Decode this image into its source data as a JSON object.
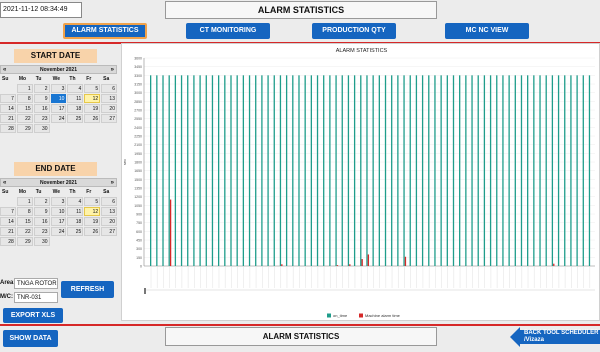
{
  "header": {
    "datetime": "2021-11-12 08:34:49",
    "title": "ALARM STATISTICS"
  },
  "nav": [
    {
      "label": "ALARM STATISTICS",
      "active": true
    },
    {
      "label": "CT MONITORING",
      "active": false
    },
    {
      "label": "PRODUCTION QTY",
      "active": false
    },
    {
      "label": "MC NC VIEW",
      "active": false
    }
  ],
  "start_date": {
    "label": "START DATE",
    "month": "November 2021",
    "weekdays": [
      "Su",
      "Mo",
      "Tu",
      "We",
      "Th",
      "Fr",
      "Sa"
    ],
    "days": [
      "",
      "1",
      "2",
      "3",
      "4",
      "5",
      "6",
      "7",
      "8",
      "9",
      "10",
      "11",
      "12",
      "13",
      "14",
      "15",
      "16",
      "17",
      "18",
      "19",
      "20",
      "21",
      "22",
      "23",
      "24",
      "25",
      "26",
      "27",
      "28",
      "29",
      "30",
      "",
      "",
      "",
      "",
      ""
    ],
    "selected": "10",
    "today": "12"
  },
  "end_date": {
    "label": "END DATE",
    "month": "November 2021",
    "weekdays": [
      "Su",
      "Mo",
      "Tu",
      "We",
      "Th",
      "Fr",
      "Sa"
    ],
    "days": [
      "",
      "1",
      "2",
      "3",
      "4",
      "5",
      "6",
      "7",
      "8",
      "9",
      "10",
      "11",
      "12",
      "13",
      "14",
      "15",
      "16",
      "17",
      "18",
      "19",
      "20",
      "21",
      "22",
      "23",
      "24",
      "25",
      "26",
      "27",
      "28",
      "29",
      "30",
      "",
      "",
      "",
      "",
      ""
    ],
    "today": "12"
  },
  "form": {
    "area_label": "Area:",
    "area_value": "TNGA ROTOR",
    "mc_label": "M/C:",
    "mc_value": "TNR-031",
    "refresh_label": "REFRESH",
    "export_label": "EXPORT XLS",
    "show_label": "SHOW DATA"
  },
  "footer": {
    "title": "ALARM STATISTICS",
    "back_line1": "BACK TOOL SCHEDULER",
    "back_line2": "/Vizaza"
  },
  "colors": {
    "accent": "#1565c0",
    "series_run": "#1f9d8b",
    "series_alarm": "#d62828"
  },
  "chart_data": {
    "type": "bar",
    "title": "ALARM STATISTICS",
    "ylabel": "sec",
    "ylim": [
      0,
      3600
    ],
    "yticks": [
      0,
      150,
      300,
      450,
      600,
      750,
      900,
      1050,
      1200,
      1350,
      1500,
      1650,
      1800,
      1950,
      2100,
      2250,
      2400,
      2550,
      2700,
      2850,
      3000,
      3150,
      3300,
      3450,
      3600
    ],
    "series": [
      {
        "name": "on_time",
        "color": "#1f9d8b",
        "constant": 3300,
        "count": 72
      },
      {
        "name": "Machine alarm time",
        "color": "#d62828",
        "values": [
          0,
          0,
          0,
          1150,
          0,
          0,
          0,
          0,
          0,
          0,
          0,
          0,
          0,
          0,
          0,
          0,
          0,
          0,
          0,
          0,
          0,
          30,
          0,
          0,
          0,
          0,
          0,
          0,
          0,
          0,
          15,
          0,
          30,
          0,
          120,
          200,
          0,
          0,
          0,
          0,
          0,
          160,
          0,
          0,
          0,
          0,
          0,
          0,
          0,
          0,
          0,
          0,
          0,
          0,
          0,
          0,
          0,
          0,
          0,
          0,
          0,
          0,
          0,
          0,
          0,
          40,
          0,
          0,
          0,
          0,
          0,
          0
        ]
      }
    ],
    "legend": "bottom-center"
  }
}
